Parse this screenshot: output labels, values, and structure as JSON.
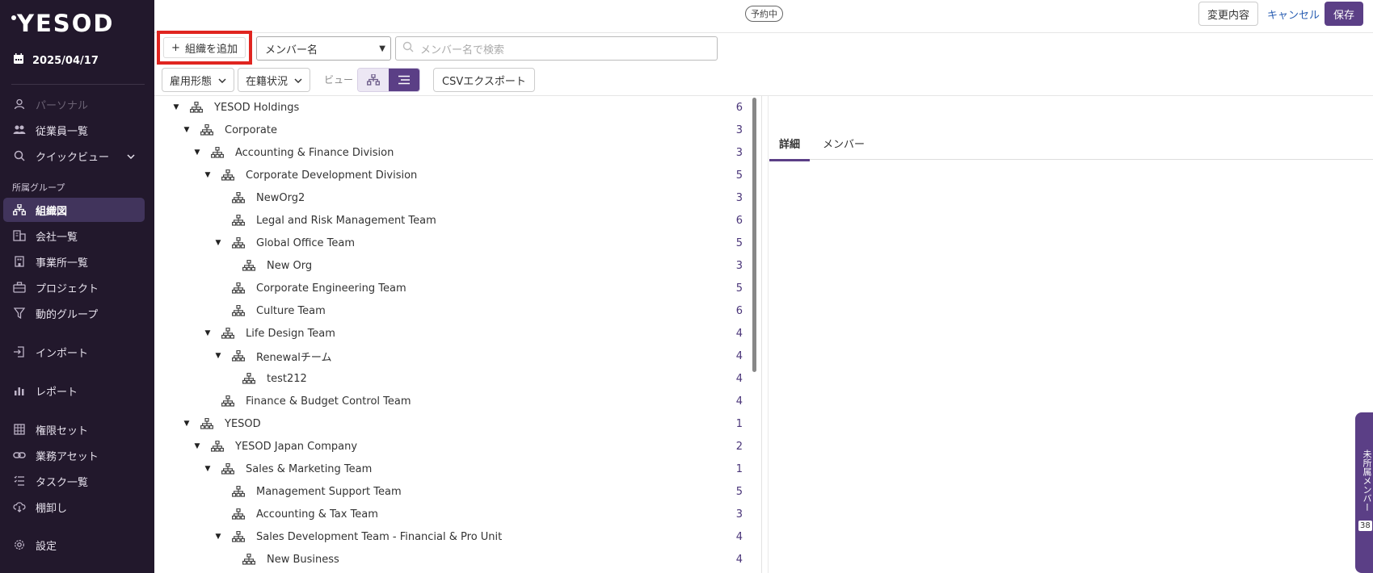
{
  "app": {
    "logo": "YESOD",
    "date": "2025/04/17"
  },
  "sidebar": {
    "items_top": [
      {
        "label": "パーソナル",
        "icon": "person-icon",
        "muted": true
      },
      {
        "label": "従業員一覧",
        "icon": "people-icon"
      },
      {
        "label": "クイックビュー",
        "icon": "search-icon"
      }
    ],
    "section_label": "所属グループ",
    "items_group": [
      {
        "label": "組織図",
        "icon": "org-chart-icon",
        "active": true
      },
      {
        "label": "会社一覧",
        "icon": "building-icon"
      },
      {
        "label": "事業所一覧",
        "icon": "office-icon"
      },
      {
        "label": "プロジェクト",
        "icon": "briefcase-icon"
      },
      {
        "label": "動的グループ",
        "icon": "filter-icon"
      }
    ],
    "items_import": [
      {
        "label": "インポート",
        "icon": "import-icon"
      }
    ],
    "items_report": [
      {
        "label": "レポート",
        "icon": "chart-icon"
      }
    ],
    "items_admin": [
      {
        "label": "権限セット",
        "icon": "grid-icon"
      },
      {
        "label": "業務アセット",
        "icon": "link-icon"
      },
      {
        "label": "タスク一覧",
        "icon": "tasklist-icon"
      },
      {
        "label": "棚卸し",
        "icon": "cloud-download-icon"
      }
    ],
    "items_settings": [
      {
        "label": "設定",
        "icon": "gear-icon"
      }
    ]
  },
  "topbar": {
    "status": "予約中",
    "changes_label": "変更内容",
    "cancel_label": "キャンセル",
    "save_label": "保存"
  },
  "toolbar": {
    "add_org_label": "組織を追加",
    "member_select_value": "メンバー名",
    "search_placeholder": "メンバー名で検索",
    "filter_employment": "雇用形態",
    "filter_status": "在籍状況",
    "view_label": "ビュー",
    "csv_label": "CSVエクスポート"
  },
  "tree": [
    {
      "name": "YESOD Holdings",
      "count": "6",
      "level": 0,
      "expanded": true
    },
    {
      "name": "Corporate",
      "count": "3",
      "level": 1,
      "expanded": true
    },
    {
      "name": "Accounting & Finance Division",
      "count": "3",
      "level": 2,
      "expanded": true
    },
    {
      "name": "Corporate Development Division",
      "count": "5",
      "level": 3,
      "expanded": true
    },
    {
      "name": "NewOrg2",
      "count": "3",
      "level": 4,
      "expanded": false
    },
    {
      "name": "Legal and Risk Management Team",
      "count": "6",
      "level": 4,
      "expanded": false
    },
    {
      "name": "Global Office Team",
      "count": "5",
      "level": 4,
      "expanded": true
    },
    {
      "name": "New Org",
      "count": "3",
      "level": 5,
      "expanded": false
    },
    {
      "name": "Corporate Engineering Team",
      "count": "5",
      "level": 4,
      "expanded": false
    },
    {
      "name": "Culture Team",
      "count": "6",
      "level": 4,
      "expanded": false
    },
    {
      "name": "Life Design Team",
      "count": "4",
      "level": 3,
      "expanded": true
    },
    {
      "name": "Renewalチーム",
      "count": "4",
      "level": 4,
      "expanded": true
    },
    {
      "name": "test212",
      "count": "4",
      "level": 5,
      "expanded": false
    },
    {
      "name": "Finance & Budget Control Team",
      "count": "4",
      "level": 3,
      "expanded": false
    },
    {
      "name": "YESOD",
      "count": "1",
      "level": 1,
      "expanded": true
    },
    {
      "name": "YESOD Japan Company",
      "count": "2",
      "level": 2,
      "expanded": true
    },
    {
      "name": "Sales & Marketing Team",
      "count": "1",
      "level": 3,
      "expanded": true
    },
    {
      "name": "Management Support Team",
      "count": "5",
      "level": 4,
      "expanded": false
    },
    {
      "name": "Accounting & Tax Team",
      "count": "3",
      "level": 4,
      "expanded": false
    },
    {
      "name": "Sales Development Team - Financial & Pro Unit",
      "count": "4",
      "level": 4,
      "expanded": true
    },
    {
      "name": "New Business",
      "count": "4",
      "level": 5,
      "expanded": false
    }
  ],
  "detail": {
    "tabs": [
      {
        "label": "詳細",
        "active": true
      },
      {
        "label": "メンバー",
        "active": false
      }
    ]
  },
  "side_tab": {
    "label": "未所属メンバー",
    "count": "38"
  },
  "colors": {
    "sidebar_bg": "#22182c",
    "accent": "#5b3f86",
    "highlight": "#e02520"
  }
}
